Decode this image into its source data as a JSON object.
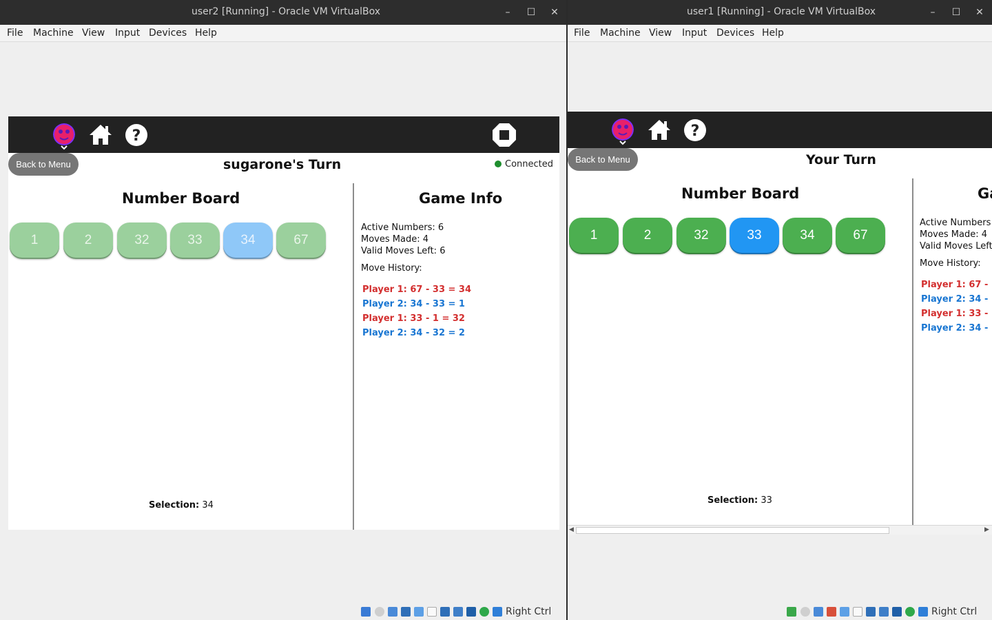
{
  "left": {
    "title": "user2 [Running] - Oracle VM VirtualBox",
    "menu": [
      "File",
      "Machine",
      "View",
      "Input",
      "Devices",
      "Help"
    ],
    "back_label": "Back to Menu",
    "turn_label": "sugarone's Turn",
    "connection": "Connected",
    "board_title": "Number Board",
    "info_title": "Game Info",
    "tiles": [
      "1",
      "2",
      "32",
      "33",
      "34",
      "67"
    ],
    "selected_tile": "34",
    "active_numbers": "Active Numbers: 6",
    "moves_made": "Moves Made: 4",
    "valid_moves": "Valid Moves Left: 6",
    "move_history_label": "Move History:",
    "history": [
      "Player 1: 67 - 33 = 34",
      "Player 2: 34 - 33 = 1",
      "Player 1: 33 - 1 = 32",
      "Player 2: 34 - 32 = 2"
    ],
    "selection_label": "Selection:",
    "selection_value": "34",
    "host_key": "Right Ctrl"
  },
  "right": {
    "title": "user1 [Running] - Oracle VM VirtualBox",
    "menu": [
      "File",
      "Machine",
      "View",
      "Input",
      "Devices",
      "Help"
    ],
    "back_label": "Back to Menu",
    "turn_label": "Your Turn",
    "board_title": "Number Board",
    "info_title": "Ga",
    "tiles": [
      "1",
      "2",
      "32",
      "33",
      "34",
      "67"
    ],
    "selected_tile": "33",
    "active_numbers": "Active Numbers",
    "moves_made": "Moves Made: 4",
    "valid_moves": "Valid Moves Left",
    "move_history_label": "Move History:",
    "history": [
      "Player 1: 67 -",
      "Player 2: 34 -",
      "Player 1: 33 -",
      "Player 2: 34 -"
    ],
    "selection_label": "Selection:",
    "selection_value": "33",
    "host_key": "Right Ctrl"
  },
  "colors": {
    "tile_green": "#4caf50",
    "tile_blue": "#2196f3",
    "player1": "#d32f2f",
    "player2": "#1976d2",
    "connected": "#1e8e2e",
    "avatar": "#e8206a"
  },
  "icons": [
    "avatar-icon",
    "home-icon",
    "help-icon",
    "stop-icon",
    "minimize-icon",
    "maximize-icon",
    "close-icon"
  ]
}
